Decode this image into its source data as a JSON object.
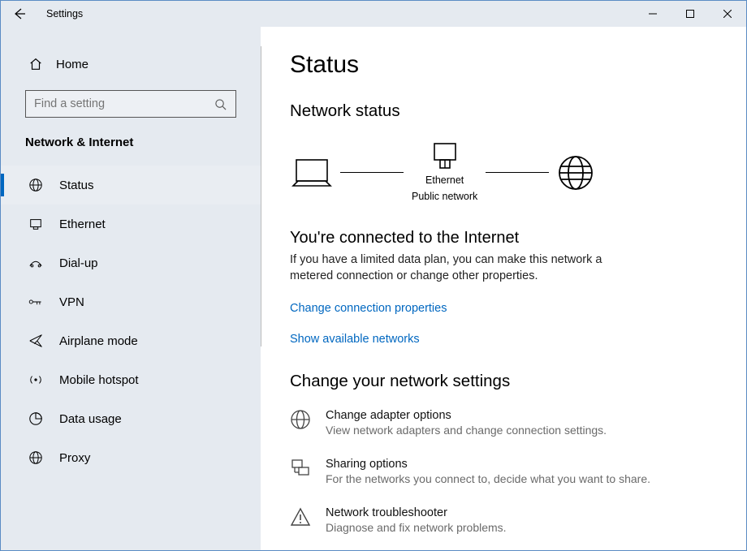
{
  "titlebar": {
    "title": "Settings"
  },
  "sidebar": {
    "home_label": "Home",
    "search_placeholder": "Find a setting",
    "category": "Network & Internet",
    "items": [
      {
        "label": "Status"
      },
      {
        "label": "Ethernet"
      },
      {
        "label": "Dial-up"
      },
      {
        "label": "VPN"
      },
      {
        "label": "Airplane mode"
      },
      {
        "label": "Mobile hotspot"
      },
      {
        "label": "Data usage"
      },
      {
        "label": "Proxy"
      }
    ]
  },
  "page": {
    "title": "Status",
    "network_status_heading": "Network status",
    "diagram": {
      "connection_name": "Ethernet",
      "network_type": "Public network"
    },
    "connected_title": "You're connected to the Internet",
    "connected_desc": "If you have a limited data plan, you can make this network a metered connection or change other properties.",
    "link_change_props": "Change connection properties",
    "link_show_networks": "Show available networks",
    "change_settings_heading": "Change your network settings",
    "options": [
      {
        "title": "Change adapter options",
        "desc": "View network adapters and change connection settings."
      },
      {
        "title": "Sharing options",
        "desc": "For the networks you connect to, decide what you want to share."
      },
      {
        "title": "Network troubleshooter",
        "desc": "Diagnose and fix network problems."
      }
    ]
  }
}
